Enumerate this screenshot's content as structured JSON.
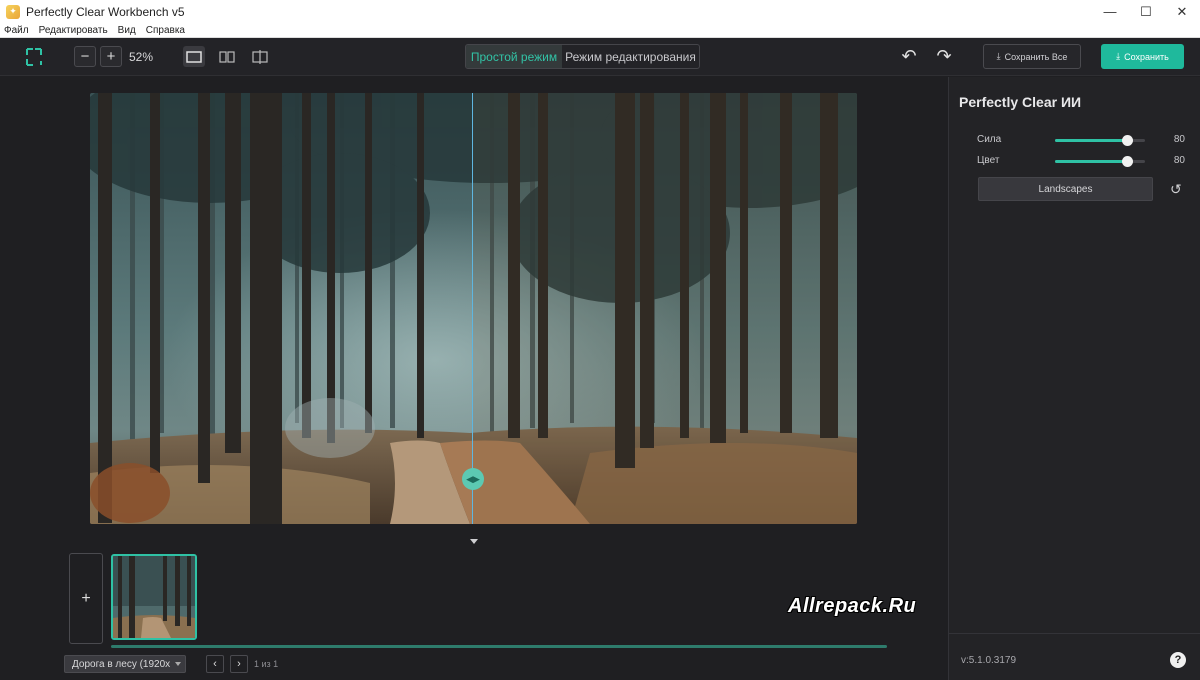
{
  "window": {
    "title": "Perfectly Clear Workbench v5",
    "minimize": "—",
    "maximize": "☐",
    "close": "✕"
  },
  "menu": [
    "Файл",
    "Редактировать",
    "Вид",
    "Справка"
  ],
  "toolbar": {
    "zoom_out": "−",
    "zoom_in": "+",
    "zoom_value": "52%",
    "mode_simple": "Простой режим",
    "mode_edit": "Режим редактирования",
    "undo": "↶",
    "redo": "↷",
    "save_all": "Сохранить Все",
    "save": "Сохранить"
  },
  "colors": {
    "accent": "#2fc2a5",
    "panel": "#232326",
    "canvas": "#1f1f22"
  },
  "filmstrip": {
    "add": "+",
    "watermark": "Allrepack.Ru",
    "file_name": "Дорога в лесу (1920x",
    "prev": "‹",
    "next": "›",
    "counter": "1 из 1"
  },
  "panel": {
    "title": "Perfectly Clear ИИ",
    "sliders": [
      {
        "label": "Сила",
        "value": "80",
        "fraction": 0.8
      },
      {
        "label": "Цвет",
        "value": "80",
        "fraction": 0.8
      }
    ],
    "preset": "Landscapes",
    "reset": "↺",
    "version": "v:5.1.0.3179",
    "help": "?"
  }
}
